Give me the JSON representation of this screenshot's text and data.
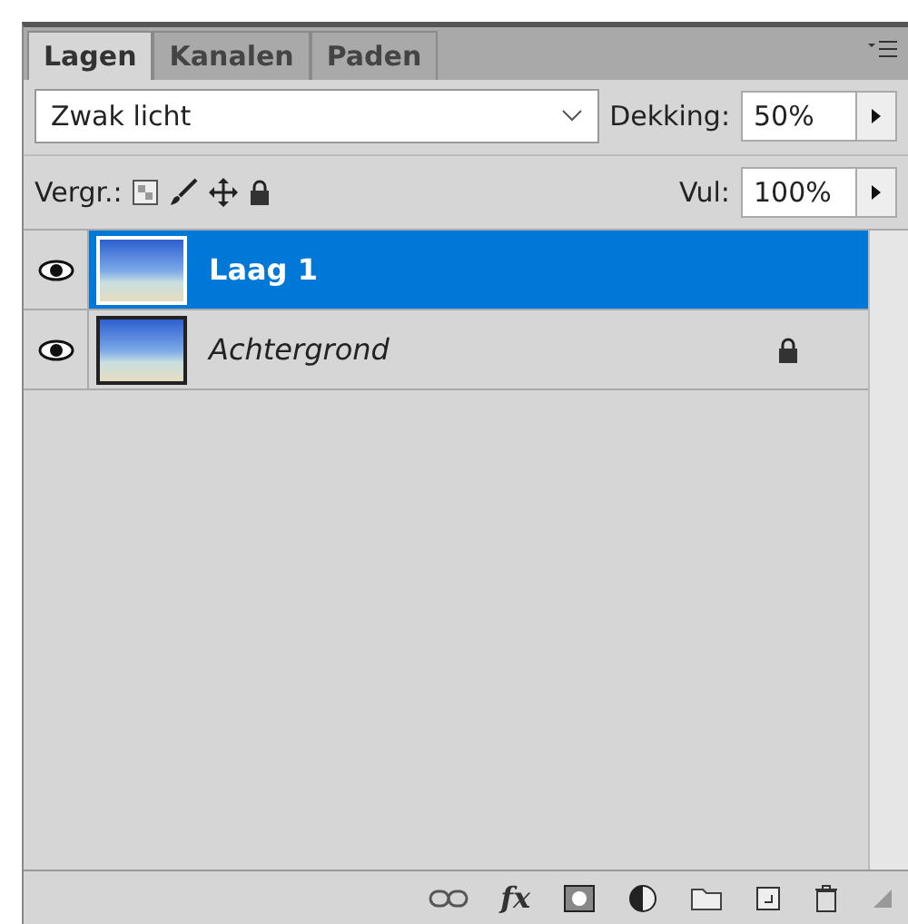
{
  "tabs": [
    {
      "label": "Lagen",
      "selected": true
    },
    {
      "label": "Kanalen",
      "selected": false
    },
    {
      "label": "Paden",
      "selected": false
    }
  ],
  "blend_mode": {
    "value": "Zwak licht"
  },
  "opacity": {
    "label": "Dekking:",
    "value": "50%"
  },
  "lock": {
    "label": "Vergr.:"
  },
  "fill": {
    "label": "Vul:",
    "value": "100%"
  },
  "layers": [
    {
      "name": "Laag 1",
      "selected": true,
      "visible": true,
      "locked": false,
      "italic": false
    },
    {
      "name": "Achtergrond",
      "selected": false,
      "visible": true,
      "locked": true,
      "italic": true
    }
  ],
  "footer": {
    "fx_label": "fx"
  }
}
